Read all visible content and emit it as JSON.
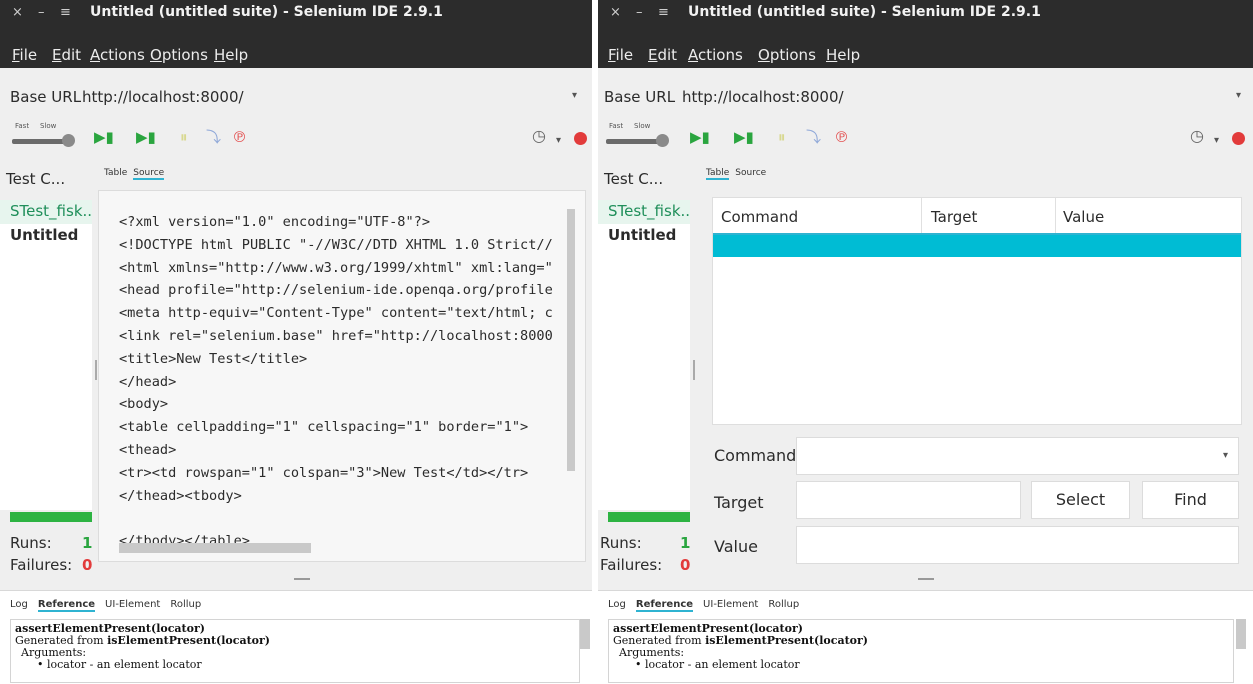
{
  "windows": [
    {
      "title": "Untitled (untitled suite) - Selenium IDE 2.9.1",
      "wm_buttons": [
        "×",
        "–",
        "≡"
      ],
      "menu": [
        "File",
        "Edit",
        "Actions",
        "Options",
        "Help"
      ],
      "base_url_label": "Base URL",
      "base_url": "http://localhost:8000/",
      "speed": {
        "fast": "Fast",
        "slow": "Slow"
      },
      "testcases": {
        "header": "Test C...",
        "items": [
          "STest_fisk...",
          "Untitled"
        ]
      },
      "runs_label": "Runs:",
      "runs": "1",
      "failures_label": "Failures:",
      "failures": "0",
      "tabs": [
        "Table",
        "Source"
      ],
      "active_tab": "Source",
      "source_lines": [
        "<?xml version=\"1.0\" encoding=\"UTF-8\"?>",
        "<!DOCTYPE html PUBLIC \"-//W3C//DTD XHTML 1.0 Strict//",
        "<html xmlns=\"http://www.w3.org/1999/xhtml\" xml:lang=\"",
        "<head profile=\"http://selenium-ide.openqa.org/profile",
        "<meta http-equiv=\"Content-Type\" content=\"text/html; c",
        "<link rel=\"selenium.base\" href=\"http://localhost:8000",
        "<title>New Test</title>",
        "</head>",
        "<body>",
        "<table cellpadding=\"1\" cellspacing=\"1\" border=\"1\">",
        "<thead>",
        "<tr><td rowspan=\"1\" colspan=\"3\">New Test</td></tr>",
        "</thead><tbody>",
        "",
        "</tbody></table>"
      ],
      "bottom_tabs": [
        "Log",
        "Reference",
        "UI-Element",
        "Rollup"
      ],
      "active_bottom_tab": "Reference",
      "reference": {
        "command": "assertElementPresent(locator)",
        "generated_prefix": "Generated from ",
        "generated_from": "isElementPresent(locator)",
        "arguments": "Arguments:",
        "arg1": "locator - an element locator"
      }
    },
    {
      "title": "Untitled (untitled suite) - Selenium IDE 2.9.1",
      "wm_buttons": [
        "×",
        "–",
        "≡"
      ],
      "menu": [
        "File",
        "Edit",
        "Actions",
        "Options",
        "Help"
      ],
      "base_url_label": "Base URL",
      "base_url": "http://localhost:8000/",
      "speed": {
        "fast": "Fast",
        "slow": "Slow"
      },
      "testcases": {
        "header": "Test C...",
        "items": [
          "STest_fisk...",
          "Untitled"
        ]
      },
      "runs_label": "Runs:",
      "runs": "1",
      "failures_label": "Failures:",
      "failures": "0",
      "tabs": [
        "Table",
        "Source"
      ],
      "active_tab": "Table",
      "table_headers": [
        "Command",
        "Target",
        "Value"
      ],
      "form": {
        "command_label": "Command",
        "command_value": "",
        "target_label": "Target",
        "target_value": "",
        "select_button": "Select",
        "find_button": "Find",
        "value_label": "Value",
        "value_value": ""
      },
      "bottom_tabs": [
        "Log",
        "Reference",
        "UI-Element",
        "Rollup"
      ],
      "active_bottom_tab": "Reference",
      "reference": {
        "command": "assertElementPresent(locator)",
        "generated_prefix": "Generated from ",
        "generated_from": "isElementPresent(locator)",
        "arguments": "Arguments:",
        "arg1": "locator - an element locator"
      }
    }
  ],
  "icons": {
    "play_suite": "▶▮",
    "play_test": "▶▮",
    "pause": "⏸",
    "step": "⤵",
    "rollup": "℗",
    "clock": "◷",
    "dropdown": "▾",
    "record": "●",
    "bullet": "•"
  },
  "colors": {
    "titlebar": "#2c2c2c",
    "accent": "#00bcd4",
    "play": "#2aa53f",
    "record": "#e23b3b",
    "selected_testcase": "#1f8f5a"
  }
}
